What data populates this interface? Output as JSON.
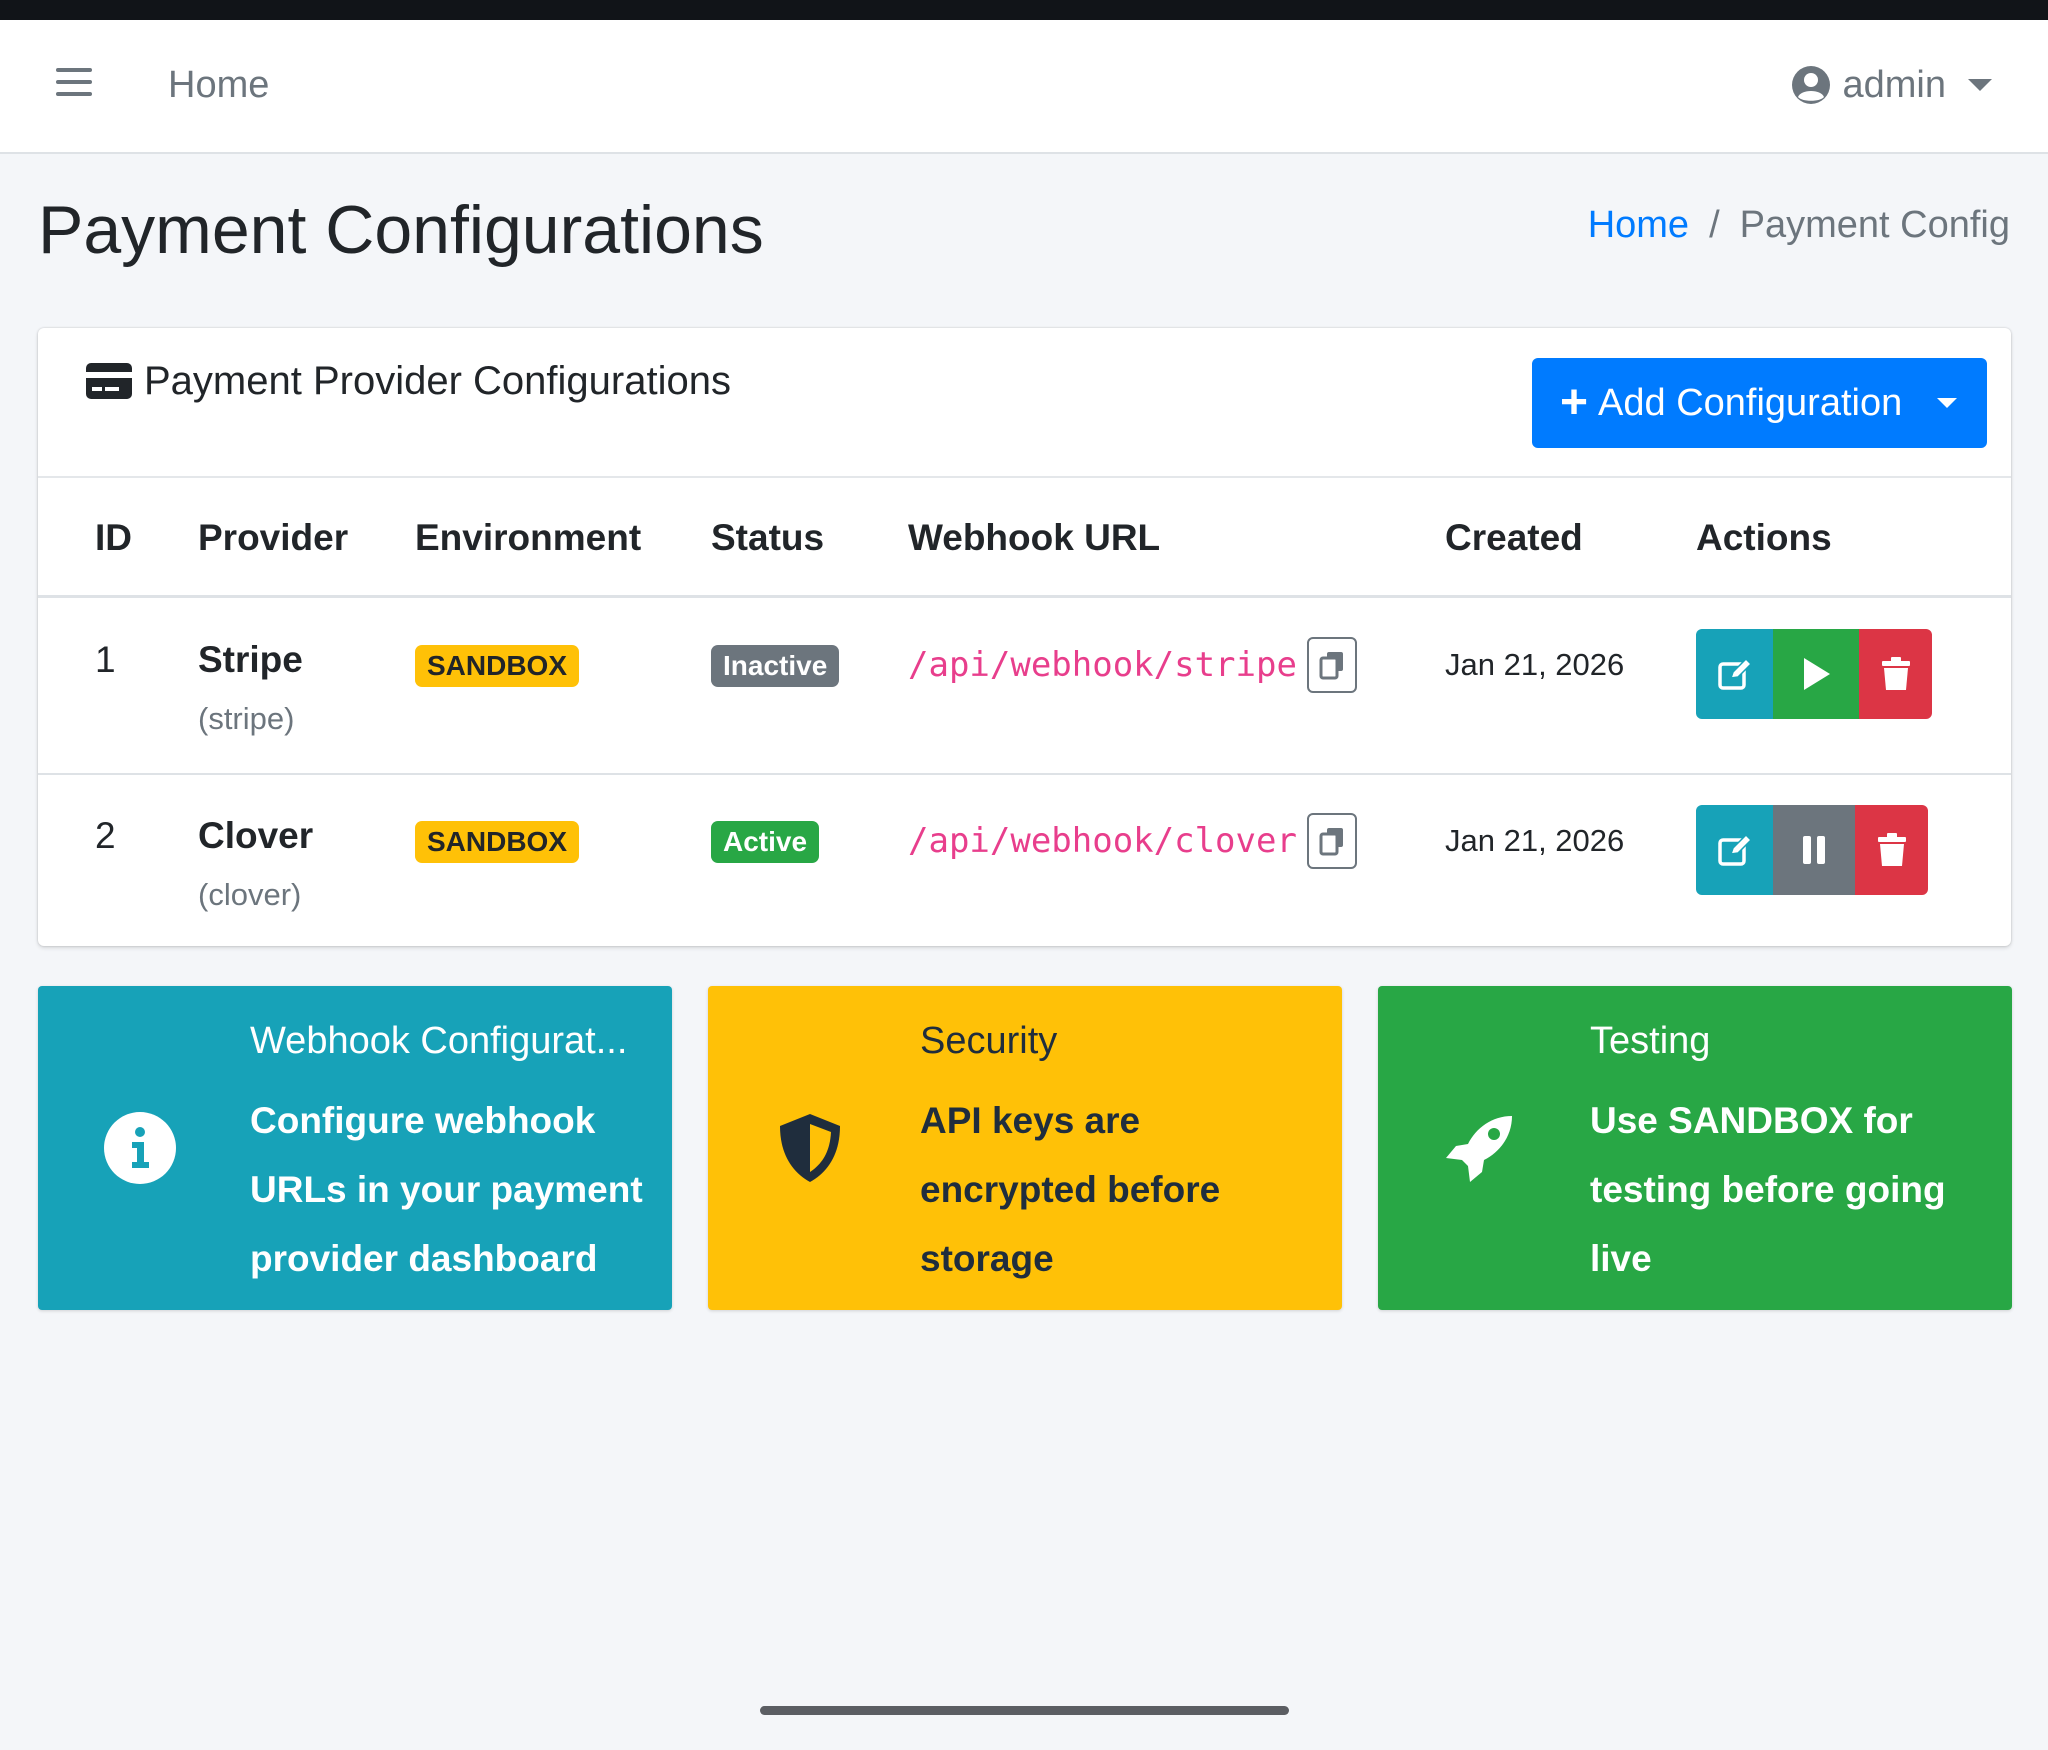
{
  "navbar": {
    "home_label": "Home",
    "user_name": "admin",
    "icons": {
      "menu": "hamburger-icon",
      "user": "user-circle-icon",
      "dropdown": "caret-down-icon"
    }
  },
  "page": {
    "title": "Payment Configurations",
    "breadcrumb": {
      "home": "Home",
      "separator": "/",
      "current": "Payment Config"
    }
  },
  "card": {
    "title": "Payment Provider Configurations",
    "icon": "credit-card-icon",
    "add_button_label": "Add Configuration"
  },
  "table": {
    "headers": [
      "ID",
      "Provider",
      "Environment",
      "Status",
      "Webhook URL",
      "Created",
      "Actions"
    ],
    "rows": [
      {
        "id": "1",
        "provider": "Stripe",
        "slug": "(stripe)",
        "environment": "SANDBOX",
        "status": "Inactive",
        "webhook_url": "/api/webhook/stripe",
        "created": "Jan 21, 2026",
        "actions": [
          "edit",
          "activate",
          "delete"
        ]
      },
      {
        "id": "2",
        "provider": "Clover",
        "slug": "(clover)",
        "environment": "SANDBOX",
        "status": "Active",
        "webhook_url": "/api/webhook/clover",
        "created": "Jan 21, 2026",
        "actions": [
          "edit",
          "deactivate",
          "delete"
        ]
      }
    ]
  },
  "info_boxes": [
    {
      "title": "Webhook Configurat...",
      "text": "Configure webhook URLs in your payment provider dashboard",
      "icon": "info-circle-icon",
      "color": "#17a2b8"
    },
    {
      "title": "Security",
      "text": "API keys are encrypted before storage",
      "icon": "shield-icon",
      "color": "#ffc107"
    },
    {
      "title": "Testing",
      "text": "Use SANDBOX for testing before going live",
      "icon": "rocket-icon",
      "color": "#28a745"
    }
  ],
  "colors": {
    "primary": "#007bff",
    "info": "#17a2b8",
    "success": "#28a745",
    "warning": "#ffc107",
    "danger": "#dc3545",
    "secondary": "#6c757d",
    "code": "#e83e8c"
  }
}
